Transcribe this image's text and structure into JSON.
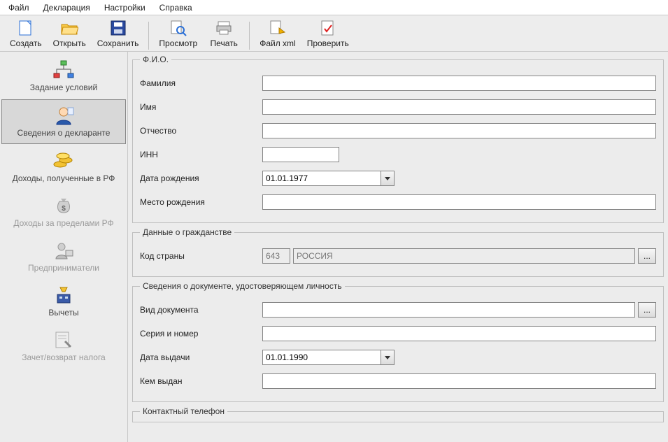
{
  "menu": {
    "file": "Файл",
    "declaration": "Декларация",
    "settings": "Настройки",
    "help": "Справка"
  },
  "toolbar": {
    "create": "Создать",
    "open": "Открыть",
    "save": "Сохранить",
    "preview": "Просмотр",
    "print": "Печать",
    "filexml": "Файл xml",
    "check": "Проверить"
  },
  "sidebar": {
    "conditions": "Задание условий",
    "declarant": "Сведения о декларанте",
    "income_rf": "Доходы, полученные в РФ",
    "income_abroad": "Доходы за пределами РФ",
    "entrepreneur": "Предприниматели",
    "deductions": "Вычеты",
    "refund": "Зачет/возврат налога"
  },
  "group_fio": {
    "legend": "Ф.И.О.",
    "surname": "Фамилия",
    "name": "Имя",
    "patronymic": "Отчество",
    "inn": "ИНН",
    "birthdate_label": "Дата рождения",
    "birthdate_value": "01.01.1977",
    "birthplace": "Место рождения"
  },
  "group_citizen": {
    "legend": "Данные о гражданстве",
    "country_code_label": "Код страны",
    "country_code_value": "643",
    "country_name_value": "РОССИЯ"
  },
  "group_doc": {
    "legend": "Сведения о документе, удостоверяющем личность",
    "doc_type": "Вид документа",
    "serial": "Серия и номер",
    "issue_date_label": "Дата выдачи",
    "issue_date_value": "01.01.1990",
    "issued_by": "Кем выдан"
  },
  "group_phone": {
    "legend": "Контактный телефон"
  },
  "misc": {
    "dots": "..."
  }
}
